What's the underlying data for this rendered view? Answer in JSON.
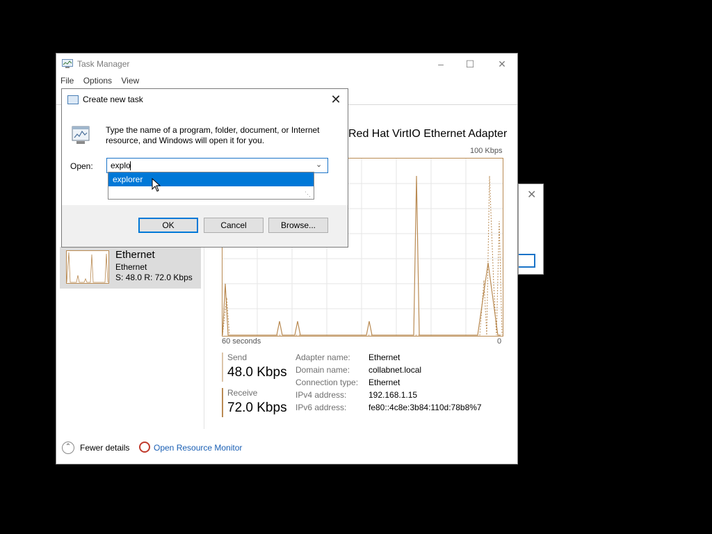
{
  "task_manager": {
    "title": "Task Manager",
    "menu": [
      "File",
      "Options",
      "View"
    ],
    "sidebar": {
      "selected": {
        "name": "Ethernet",
        "sub": "Ethernet",
        "stats": "S: 48.0 R: 72.0 Kbps"
      }
    },
    "adapter_title": "Red Hat VirtIO Ethernet Adapter",
    "graph": {
      "max_label": "100 Kbps",
      "x_left": "60 seconds",
      "x_right": "0"
    },
    "send": {
      "label": "Send",
      "value": "48.0 Kbps"
    },
    "receive": {
      "label": "Receive",
      "value": "72.0 Kbps"
    },
    "properties": [
      {
        "key": "Adapter name:",
        "value": "Ethernet"
      },
      {
        "key": "Domain name:",
        "value": "collabnet.local"
      },
      {
        "key": "Connection type:",
        "value": "Ethernet"
      },
      {
        "key": "IPv4 address:",
        "value": "192.168.1.15"
      },
      {
        "key": "IPv6 address:",
        "value": "fe80::4c8e:3b84:110d:78b8%7"
      }
    ],
    "footer": {
      "fewer_details": "Fewer details",
      "resource_monitor": "Open Resource Monitor"
    }
  },
  "dialog": {
    "title": "Create new task",
    "description": "Type the name of a program, folder, document, or Internet resource, and Windows will open it for you.",
    "open_label": "Open:",
    "input_value": "explo",
    "autocomplete": [
      "explorer"
    ],
    "buttons": {
      "ok": "OK",
      "cancel": "Cancel",
      "browse": "Browse..."
    }
  },
  "colors": {
    "accent": "#0078d7",
    "graph": "#b98a52"
  }
}
